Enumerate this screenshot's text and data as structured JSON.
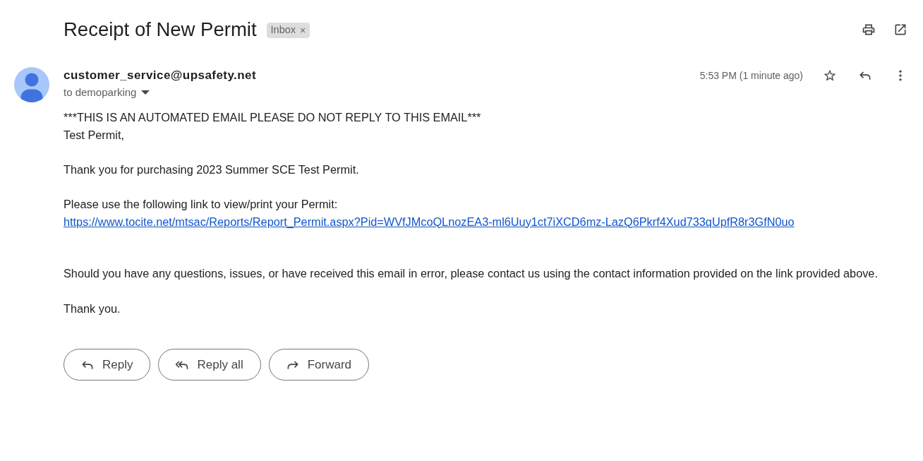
{
  "subject": {
    "title": "Receipt of New Permit",
    "labels": [
      {
        "name": "Inbox",
        "remove": "×"
      }
    ]
  },
  "message": {
    "sender": "customer_service@upsafety.net",
    "recipient": "to demoparking",
    "time": "5:53 PM (1 minute ago)",
    "starred": false,
    "body": [
      {
        "kind": "text",
        "text": "***THIS IS AN AUTOMATED EMAIL PLEASE DO NOT REPLY TO THIS EMAIL***"
      },
      {
        "kind": "text",
        "text": "Test Permit,"
      },
      {
        "kind": "break"
      },
      {
        "kind": "text",
        "text": "Thank you for purchasing 2023 Summer SCE Test Permit."
      },
      {
        "kind": "break"
      },
      {
        "kind": "text",
        "text": "Please use the following link to view/print your Permit:"
      },
      {
        "kind": "link",
        "text": "https://www.tocite.net/mtsac/Reports/Report_Permit.aspx?Pid=WVfJMcoQLnozEA3-ml6Uuy1ct7iXCD6mz-LazQ6Pkrf4Xud733qUpfR8r3GfN0uo"
      },
      {
        "kind": "break"
      },
      {
        "kind": "break"
      },
      {
        "kind": "text",
        "text": "Should you have any questions, issues, or have received this email in error, please contact us using the contact information provided on the link provided above."
      },
      {
        "kind": "break"
      },
      {
        "kind": "text",
        "text": "Thank you."
      }
    ]
  },
  "actions": [
    {
      "kind": "reply",
      "label": "Reply"
    },
    {
      "kind": "reply_all",
      "label": "Reply all"
    },
    {
      "kind": "forward",
      "label": "Forward"
    }
  ]
}
